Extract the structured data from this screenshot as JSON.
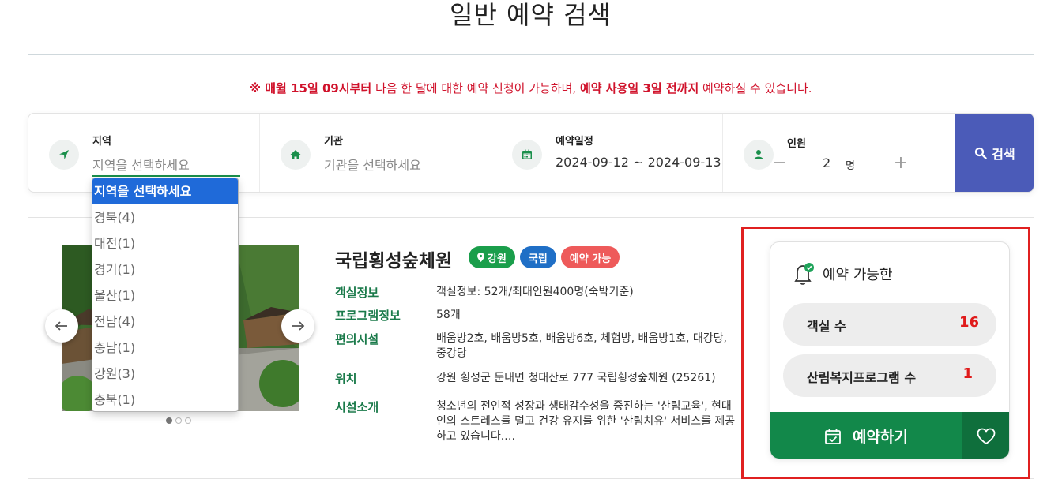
{
  "page": {
    "title": "일반 예약 검색",
    "notice_prefix": "※ 매월 15일 09시부터",
    "notice_mid": " 다음 한 달에 대한 예약 신청이 가능하며, ",
    "notice_bold2": "예약 사용일 3일 전까지",
    "notice_suffix": " 예약하실 수 있습니다."
  },
  "search": {
    "region_label": "지역",
    "region_placeholder": "지역을 선택하세요",
    "org_label": "기관",
    "org_placeholder": "기관을 선택하세요",
    "date_label": "예약일정",
    "date_value": "2024-09-12 ~ 2024-09-13",
    "people_label": "인원",
    "people_minus": "−",
    "people_count": "2",
    "people_unit": "명",
    "people_plus": "+",
    "search_button": "검색"
  },
  "dropdown": {
    "options": [
      {
        "label": "지역을 선택하세요",
        "selected": true
      },
      {
        "label": "경북(4)"
      },
      {
        "label": "대전(1)"
      },
      {
        "label": "경기(1)"
      },
      {
        "label": "울산(1)"
      },
      {
        "label": "전남(4)"
      },
      {
        "label": "충남(1)"
      },
      {
        "label": "강원(3)"
      },
      {
        "label": "충북(1)"
      }
    ]
  },
  "facility": {
    "name": "국립횡성숲체원",
    "badge_region": "강원",
    "badge_type": "국립",
    "badge_status": "예약 가능",
    "rows": [
      {
        "key": "객실정보",
        "value": "객실정보: 52개/최대인원400명(숙박기준)"
      },
      {
        "key": "프로그램정보",
        "value": "58개"
      },
      {
        "key": "편의시설",
        "value": "배움방2호, 배움방5호, 배움방6호, 체험방, 배움방1호, 대강당, 중강당"
      },
      {
        "key": "위치",
        "value": "강원 횡성군 둔내면 청태산로 777 국립횡성숲체원 (25261)"
      },
      {
        "key": "시설소개",
        "value": "청소년의 전인적 성장과 생태감수성을 증진하는 '산림교육', 현대인의 스트레스를 덜고 건강 유지를 위한 '산림치유' 서비스를 제공하고 있습니다.…"
      }
    ]
  },
  "availability": {
    "heading": "예약 가능한",
    "rooms_label": "객실 수",
    "rooms_value": "16",
    "programs_label": "산림복지프로그램 수",
    "programs_value": "1",
    "reserve_button": "예약하기"
  },
  "colors": {
    "accent_green": "#12884a",
    "search_blue": "#4b5bb8",
    "notice_red": "#d0122b",
    "highlight_red": "#e02020"
  },
  "icons": {
    "region": "location-arrow-icon",
    "org": "home-icon",
    "date": "calendar-icon",
    "people": "user-icon",
    "search": "search-icon",
    "bell": "bell-check-icon",
    "reserve": "calendar-check-icon",
    "heart": "heart-icon"
  }
}
